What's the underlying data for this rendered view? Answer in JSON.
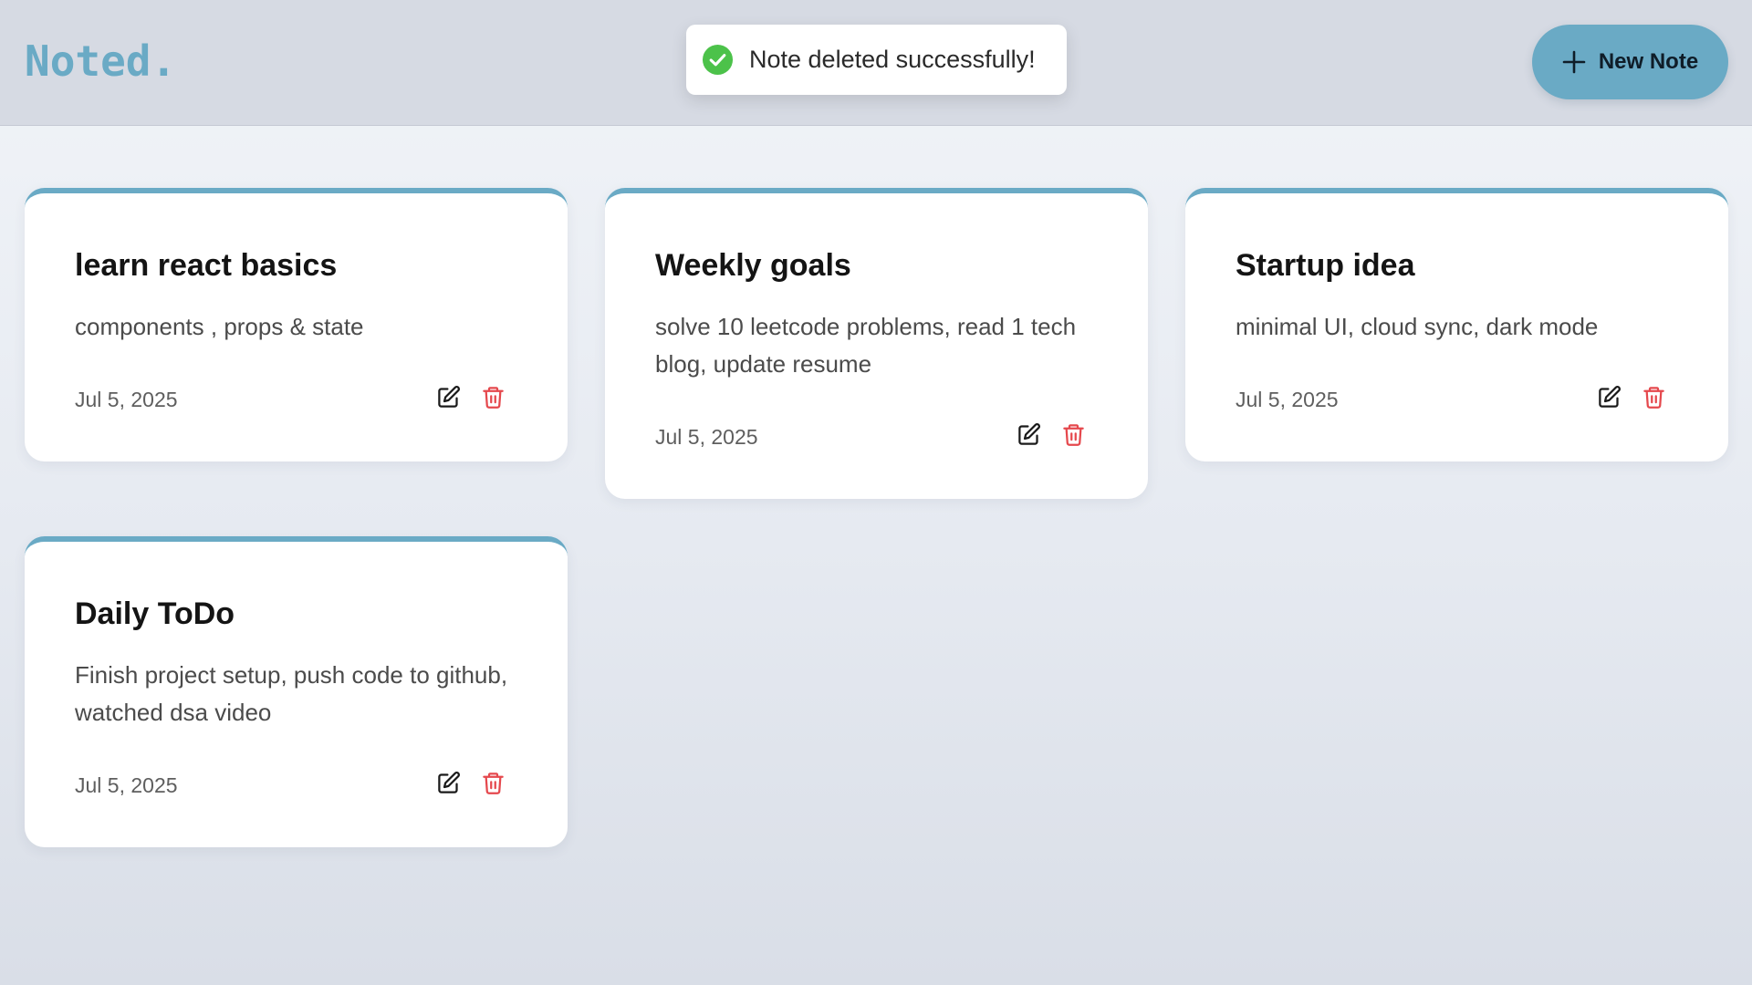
{
  "app": {
    "logo": "Noted."
  },
  "header": {
    "new_note_label": "New Note"
  },
  "toast": {
    "message": "Note deleted successfully!"
  },
  "notes": [
    {
      "title": "learn react basics",
      "body": "components , props & state",
      "date": "Jul 5, 2025"
    },
    {
      "title": "Weekly goals",
      "body": "solve 10 leetcode problems, read 1 tech blog, update resume",
      "date": "Jul 5, 2025"
    },
    {
      "title": "Startup idea",
      "body": "minimal UI, cloud sync, dark mode",
      "date": "Jul 5, 2025"
    },
    {
      "title": "Daily ToDo",
      "body": "Finish project setup, push code to github, watched dsa video",
      "date": "Jul 5, 2025"
    }
  ],
  "icons": {
    "new_note": "plus-icon",
    "toast": "check-circle-icon",
    "edit": "edit-icon",
    "delete": "trash-icon"
  },
  "colors": {
    "accent": "#6aaac5",
    "success": "#4cc24a",
    "delete": "#e5484d",
    "header_bg": "#d6dae3"
  }
}
